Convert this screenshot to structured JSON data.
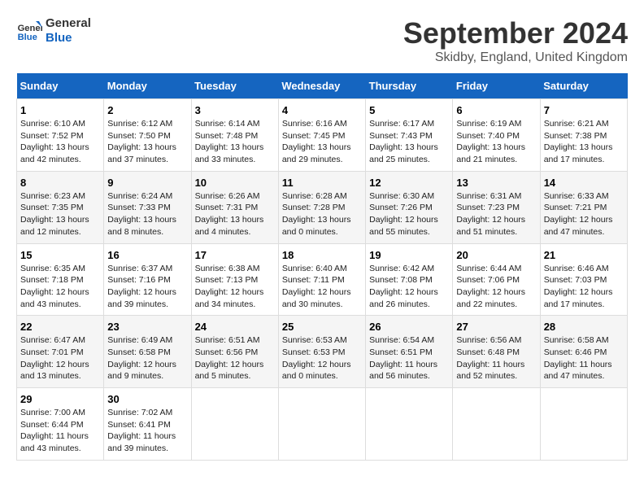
{
  "logo": {
    "line1": "General",
    "line2": "Blue"
  },
  "title": "September 2024",
  "location": "Skidby, England, United Kingdom",
  "days_header": [
    "Sunday",
    "Monday",
    "Tuesday",
    "Wednesday",
    "Thursday",
    "Friday",
    "Saturday"
  ],
  "weeks": [
    [
      {
        "day": "1",
        "sunrise": "6:10 AM",
        "sunset": "7:52 PM",
        "daylight": "13 hours and 42 minutes."
      },
      {
        "day": "2",
        "sunrise": "6:12 AM",
        "sunset": "7:50 PM",
        "daylight": "13 hours and 37 minutes."
      },
      {
        "day": "3",
        "sunrise": "6:14 AM",
        "sunset": "7:48 PM",
        "daylight": "13 hours and 33 minutes."
      },
      {
        "day": "4",
        "sunrise": "6:16 AM",
        "sunset": "7:45 PM",
        "daylight": "13 hours and 29 minutes."
      },
      {
        "day": "5",
        "sunrise": "6:17 AM",
        "sunset": "7:43 PM",
        "daylight": "13 hours and 25 minutes."
      },
      {
        "day": "6",
        "sunrise": "6:19 AM",
        "sunset": "7:40 PM",
        "daylight": "13 hours and 21 minutes."
      },
      {
        "day": "7",
        "sunrise": "6:21 AM",
        "sunset": "7:38 PM",
        "daylight": "13 hours and 17 minutes."
      }
    ],
    [
      {
        "day": "8",
        "sunrise": "6:23 AM",
        "sunset": "7:35 PM",
        "daylight": "13 hours and 12 minutes."
      },
      {
        "day": "9",
        "sunrise": "6:24 AM",
        "sunset": "7:33 PM",
        "daylight": "13 hours and 8 minutes."
      },
      {
        "day": "10",
        "sunrise": "6:26 AM",
        "sunset": "7:31 PM",
        "daylight": "13 hours and 4 minutes."
      },
      {
        "day": "11",
        "sunrise": "6:28 AM",
        "sunset": "7:28 PM",
        "daylight": "13 hours and 0 minutes."
      },
      {
        "day": "12",
        "sunrise": "6:30 AM",
        "sunset": "7:26 PM",
        "daylight": "12 hours and 55 minutes."
      },
      {
        "day": "13",
        "sunrise": "6:31 AM",
        "sunset": "7:23 PM",
        "daylight": "12 hours and 51 minutes."
      },
      {
        "day": "14",
        "sunrise": "6:33 AM",
        "sunset": "7:21 PM",
        "daylight": "12 hours and 47 minutes."
      }
    ],
    [
      {
        "day": "15",
        "sunrise": "6:35 AM",
        "sunset": "7:18 PM",
        "daylight": "12 hours and 43 minutes."
      },
      {
        "day": "16",
        "sunrise": "6:37 AM",
        "sunset": "7:16 PM",
        "daylight": "12 hours and 39 minutes."
      },
      {
        "day": "17",
        "sunrise": "6:38 AM",
        "sunset": "7:13 PM",
        "daylight": "12 hours and 34 minutes."
      },
      {
        "day": "18",
        "sunrise": "6:40 AM",
        "sunset": "7:11 PM",
        "daylight": "12 hours and 30 minutes."
      },
      {
        "day": "19",
        "sunrise": "6:42 AM",
        "sunset": "7:08 PM",
        "daylight": "12 hours and 26 minutes."
      },
      {
        "day": "20",
        "sunrise": "6:44 AM",
        "sunset": "7:06 PM",
        "daylight": "12 hours and 22 minutes."
      },
      {
        "day": "21",
        "sunrise": "6:46 AM",
        "sunset": "7:03 PM",
        "daylight": "12 hours and 17 minutes."
      }
    ],
    [
      {
        "day": "22",
        "sunrise": "6:47 AM",
        "sunset": "7:01 PM",
        "daylight": "12 hours and 13 minutes."
      },
      {
        "day": "23",
        "sunrise": "6:49 AM",
        "sunset": "6:58 PM",
        "daylight": "12 hours and 9 minutes."
      },
      {
        "day": "24",
        "sunrise": "6:51 AM",
        "sunset": "6:56 PM",
        "daylight": "12 hours and 5 minutes."
      },
      {
        "day": "25",
        "sunrise": "6:53 AM",
        "sunset": "6:53 PM",
        "daylight": "12 hours and 0 minutes."
      },
      {
        "day": "26",
        "sunrise": "6:54 AM",
        "sunset": "6:51 PM",
        "daylight": "11 hours and 56 minutes."
      },
      {
        "day": "27",
        "sunrise": "6:56 AM",
        "sunset": "6:48 PM",
        "daylight": "11 hours and 52 minutes."
      },
      {
        "day": "28",
        "sunrise": "6:58 AM",
        "sunset": "6:46 PM",
        "daylight": "11 hours and 47 minutes."
      }
    ],
    [
      {
        "day": "29",
        "sunrise": "7:00 AM",
        "sunset": "6:44 PM",
        "daylight": "11 hours and 43 minutes."
      },
      {
        "day": "30",
        "sunrise": "7:02 AM",
        "sunset": "6:41 PM",
        "daylight": "11 hours and 39 minutes."
      },
      null,
      null,
      null,
      null,
      null
    ]
  ]
}
